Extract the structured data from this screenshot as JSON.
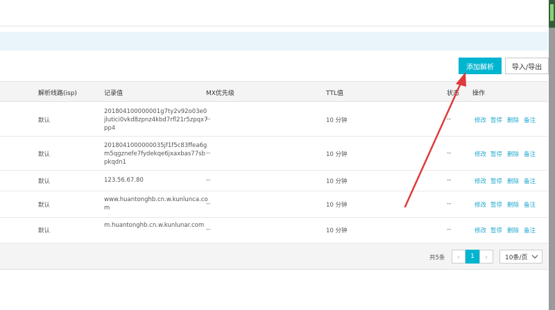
{
  "toolbar": {
    "add_label": "添加解析",
    "io_label": "导入/导出"
  },
  "table": {
    "headers": {
      "isp": "解析线路(isp)",
      "value": "记录值",
      "mx": "MX优先级",
      "ttl": "TTL值",
      "status": "状态",
      "ops": "操作"
    },
    "rows": [
      {
        "isp": "默认",
        "value": "201804100000001g7ty2v92o03e0jlutici0vkd8zpnz4kbd7rfl21r5zpqx7pp4",
        "mx": "--",
        "ttl": "10 分钟",
        "status": "--"
      },
      {
        "isp": "默认",
        "value": "2018041000000035jf1f5c83ffea6gm5qgznefe7fydekqe6jxaxbas77sbpkqdn1",
        "mx": "--",
        "ttl": "10 分钟",
        "status": "--"
      },
      {
        "isp": "默认",
        "value": "123.56.67.80",
        "mx": "--",
        "ttl": "10 分钟",
        "status": "--"
      },
      {
        "isp": "默认",
        "value": "www.huantonghb.cn.w.kunlunca.com",
        "mx": "--",
        "ttl": "10 分钟",
        "status": "--"
      },
      {
        "isp": "默认",
        "value": "m.huantonghb.cn.w.kunlunar.com",
        "mx": "--",
        "ttl": "10 分钟",
        "status": "--"
      }
    ],
    "actions": {
      "edit": "修改",
      "pause": "暂停",
      "delete": "删除",
      "note": "备注"
    }
  },
  "pagination": {
    "total": "共5条",
    "current": "1",
    "page_size": "10条/页"
  },
  "colors": {
    "accent": "#00b5d0",
    "link": "#21a8cf",
    "annotation_arrow": "#e0393a"
  },
  "icons": {
    "prev": "chevron-left-icon",
    "next": "chevron-right-icon",
    "dropdown": "chevron-down-icon"
  }
}
